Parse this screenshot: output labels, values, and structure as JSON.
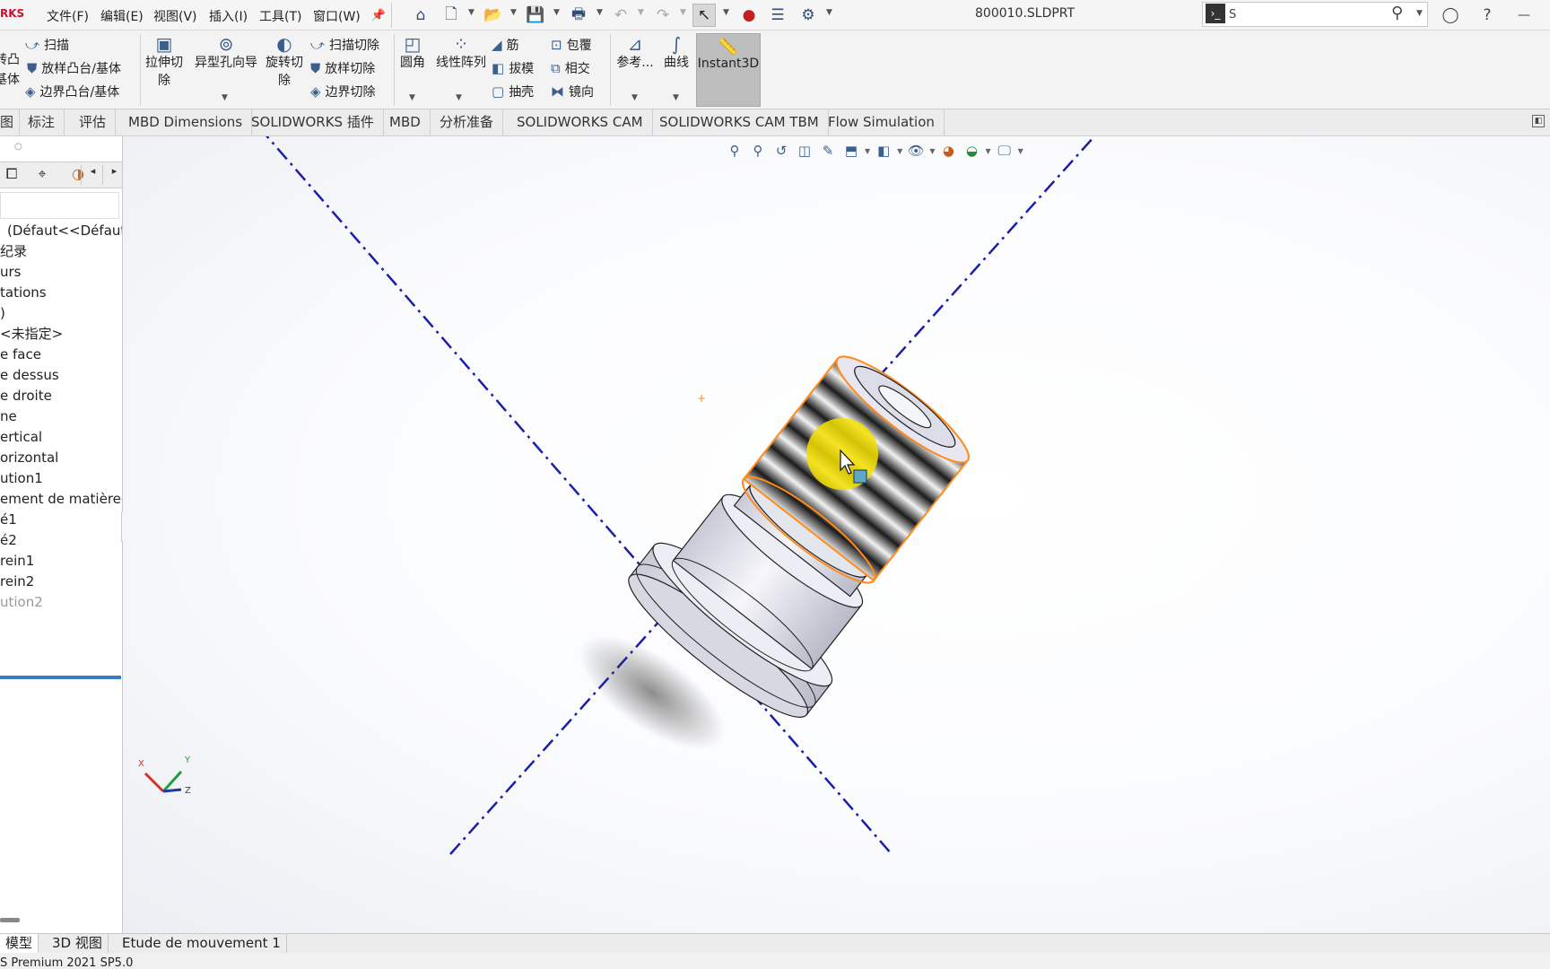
{
  "app": {
    "logo_text": "RKS",
    "document_title": "800010.SLDPRT"
  },
  "menu": [
    "文件(F)",
    "编辑(E)",
    "视图(V)",
    "插入(I)",
    "工具(T)",
    "窗口(W)"
  ],
  "search": {
    "value": "S"
  },
  "ribbon": {
    "group_boss": {
      "sweep": "扫描",
      "loft": "放样凸台/基体",
      "boundary": "边界凸台/基体",
      "revolve_partial_1": "转凸",
      "revolve_partial_2": "基体"
    },
    "group_cut": {
      "extrude_cut_1": "拉伸切",
      "extrude_cut_2": "除",
      "hole_wizard": "异型孔向导",
      "revolve_cut_1": "旋转切",
      "revolve_cut_2": "除",
      "sweep_cut": "扫描切除",
      "loft_cut": "放样切除",
      "boundary_cut": "边界切除"
    },
    "group_features": {
      "fillet": "圆角",
      "linear_pattern": "线性阵列",
      "rib": "筋",
      "draft": "拔模",
      "shell": "抽壳",
      "wrap": "包覆",
      "intersect": "相交",
      "mirror": "镜向"
    },
    "group_ref": {
      "reference": "参考...",
      "curves": "曲线"
    },
    "instant3d": "Instant3D"
  },
  "tabs": [
    "图",
    "标注",
    "评估",
    "MBD Dimensions",
    "SOLIDWORKS 插件",
    "MBD",
    "分析准备",
    "SOLIDWORKS CAM",
    "SOLIDWORKS CAM TBM",
    "Flow Simulation"
  ],
  "tree": {
    "items": [
      "(Défaut<<Défaut>",
      "纪录",
      "urs",
      "tations",
      ")",
      "<未指定>",
      "e face",
      "e dessus",
      "e droite",
      "ne",
      "ertical",
      "orizontal",
      "ution1",
      "ement de matière-P",
      "é1",
      "é2",
      "rein1",
      "rein2",
      "ution2"
    ]
  },
  "bottom_tabs": [
    "模型",
    "3D 视图",
    "Etude de mouvement 1"
  ],
  "status": {
    "text": "S Premium 2021 SP5.0"
  },
  "triad": {
    "x": "X",
    "y": "Y",
    "z": "Z"
  },
  "colors": {
    "axis_line": "#1b1fa8",
    "selection_edge": "#ff8c1a",
    "cursor_highlight": "#f5e000"
  }
}
